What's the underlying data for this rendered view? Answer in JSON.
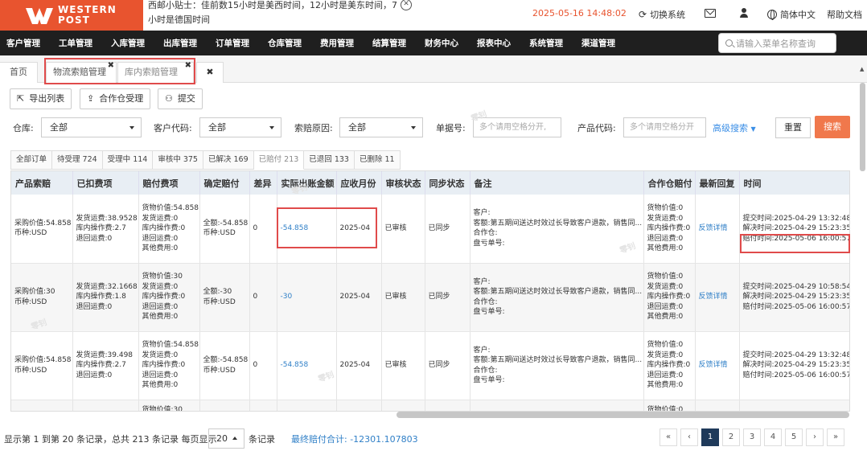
{
  "brand": {
    "line1": "WESTERN",
    "line2": "POST"
  },
  "tip": {
    "text": "西邮小贴士：佳前数15小时是美西时间，12小时是美东时间，7小时是德国时间"
  },
  "header": {
    "datetime": "2025-05-16 14:48:02",
    "switch_label": "切换系统",
    "lang_label": "简体中文",
    "help_label": "帮助文档"
  },
  "nav": {
    "items": [
      "客户管理",
      "工单管理",
      "入库管理",
      "出库管理",
      "订单管理",
      "仓库管理",
      "费用管理",
      "结算管理",
      "财务中心",
      "报表中心",
      "系统管理",
      "渠道管理"
    ],
    "search_placeholder": "请输入菜单名称查询"
  },
  "tabs": {
    "home": "首页",
    "t1": "物流索赔管理",
    "t2": "库内索赔管理",
    "close": "✖"
  },
  "toolbar": {
    "export": "导出列表",
    "cowh": "合作仓受理",
    "submit": "提交"
  },
  "filters": {
    "warehouse_label": "仓库:",
    "warehouse_value": "全部",
    "customer_label": "客户代码:",
    "customer_value": "全部",
    "reason_label": "索赔原因:",
    "reason_value": "全部",
    "order_label": "单据号:",
    "order_placeholder": "多个请用空格分开,",
    "product_label": "产品代码:",
    "product_placeholder": "多个请用空格分开",
    "advanced": "高级搜索",
    "reset": "重置",
    "search": "搜索"
  },
  "status_tabs": [
    "全部订单",
    "待受理 724",
    "受理中 114",
    "审核中 375",
    "已解决 169",
    "已赔付 213",
    "已退回 133",
    "已删除 11"
  ],
  "columns": [
    "产品索赔",
    "已扣费项",
    "赔付费项",
    "确定赔付",
    "差异",
    "实际出账金额",
    "应收月份",
    "审核状态",
    "同步状态",
    "备注",
    "合作仓赔付",
    "最新回复",
    "时间"
  ],
  "rows": [
    {
      "product": [
        "采购价值:54.858",
        "币种:USD"
      ],
      "deducted": [
        "发货运费:38.9528",
        "库内操作费:2.7",
        "退回运费:0"
      ],
      "pay": [
        "货物价值:54.858",
        "发货运费:0",
        "库内操作费:0",
        "退回运费:0",
        "其他费用:0"
      ],
      "confirm": [
        "全额:-54.858",
        "币种:USD"
      ],
      "diff": "0",
      "actual": "-54.858",
      "month": "2025-04",
      "audit": "已审核",
      "sync": "已同步",
      "remark": [
        "客户:",
        "客额:第五期间送达时效过长导致客户退款，销售同...",
        "合作仓:",
        "盘亏单号:"
      ],
      "cowh": [
        "货物价值:0",
        "发货运费:0",
        "库内操作费:0",
        "退回运费:0",
        "其他费用:0"
      ],
      "reply": "反馈详情",
      "time": [
        "提交时间:2025-04-29 13:32:48",
        "解决时间:2025-04-29 15:23:35",
        "赔付时间:2025-05-06 16:00:57"
      ]
    },
    {
      "product": [
        "采购价值:30",
        "币种:USD"
      ],
      "deducted": [
        "发货运费:32.1668",
        "库内操作费:1.8",
        "退回运费:0"
      ],
      "pay": [
        "货物价值:30",
        "发货运费:0",
        "库内操作费:0",
        "退回运费:0",
        "其他费用:0"
      ],
      "confirm": [
        "全额:-30",
        "币种:USD"
      ],
      "diff": "0",
      "actual": "-30",
      "month": "2025-04",
      "audit": "已审核",
      "sync": "已同步",
      "remark": [
        "客户:",
        "客额:第五期间送达时效过长导致客户退款，销售同...",
        "合作仓:",
        "盘亏单号:"
      ],
      "cowh": [
        "货物价值:0",
        "发货运费:0",
        "库内操作费:0",
        "退回运费:0",
        "其他费用:0"
      ],
      "reply": "反馈详情",
      "time": [
        "提交时间:2025-04-29 10:58:54",
        "解决时间:2025-04-29 15:23:35",
        "赔付时间:2025-05-06 16:00:57"
      ]
    },
    {
      "product": [
        "采购价值:54.858",
        "币种:USD"
      ],
      "deducted": [
        "发货运费:39.498",
        "库内操作费:2.7",
        "退回运费:0"
      ],
      "pay": [
        "货物价值:54.858",
        "发货运费:0",
        "库内操作费:0",
        "退回运费:0",
        "其他费用:0"
      ],
      "confirm": [
        "全额:-54.858",
        "币种:USD"
      ],
      "diff": "0",
      "actual": "-54.858",
      "month": "2025-04",
      "audit": "已审核",
      "sync": "已同步",
      "remark": [
        "客户:",
        "客额:第五期间送达时效过长导致客户退款，销售同...",
        "合作仓:",
        "盘亏单号:"
      ],
      "cowh": [
        "货物价值:0",
        "发货运费:0",
        "库内操作费:0",
        "退回运费:0",
        "其他费用:0"
      ],
      "reply": "反馈详情",
      "time": [
        "提交时间:2025-04-29 13:32:48",
        "解决时间:2025-04-29 15:23:35",
        "赔付时间:2025-05-06 16:00:57"
      ]
    },
    {
      "product": [
        ""
      ],
      "deducted": [
        ""
      ],
      "pay": [
        "货物价值:30"
      ],
      "confirm": [
        ""
      ],
      "diff": "",
      "actual": "",
      "month": "",
      "audit": "",
      "sync": "",
      "remark": [
        ""
      ],
      "cowh": [
        "货物价值:0"
      ],
      "reply": "",
      "time": [
        ""
      ]
    }
  ],
  "footer": {
    "info": "显示第 1 到第 20 条记录，总共 213 条记录 每页显示",
    "page_size": "20",
    "tail": "条记录",
    "total": "最终赔付合计: -12301.107803",
    "pages": [
      "«",
      "‹",
      "1",
      "2",
      "3",
      "4",
      "5",
      "›",
      "»"
    ]
  },
  "watermark": "零钊"
}
